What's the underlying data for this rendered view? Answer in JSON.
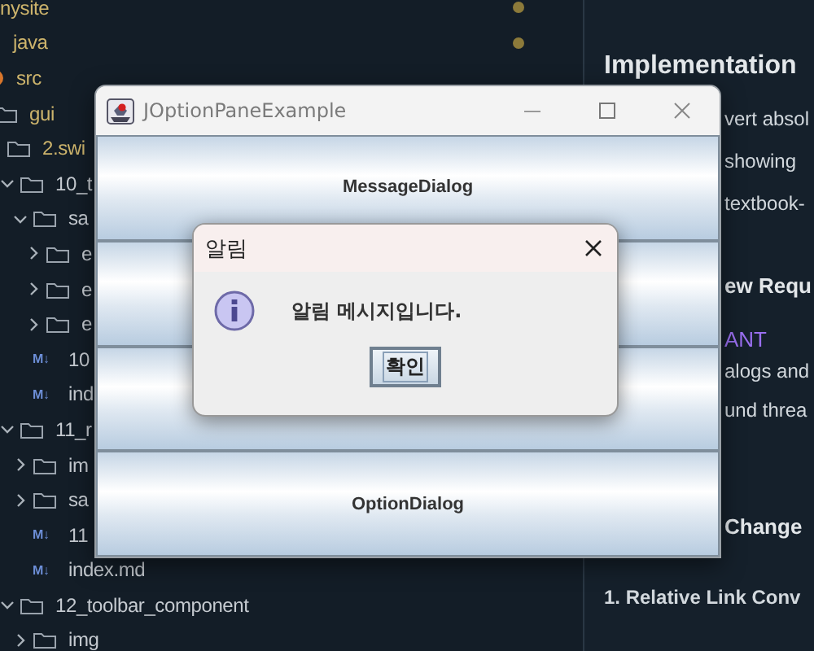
{
  "sidebar": {
    "tree": [
      {
        "label": "nysite",
        "kind": "root",
        "modified": true,
        "dirty": true,
        "children": [
          {
            "label": "java",
            "kind": "root",
            "modified": true,
            "dirty": true,
            "children": [
              {
                "label": "src",
                "kind": "source",
                "modified": true,
                "children": [
                  {
                    "label": "gui",
                    "kind": "folder",
                    "modified": true,
                    "children": [
                      {
                        "label": "2.swi",
                        "kind": "folder",
                        "modified": true,
                        "children": [
                          {
                            "label": "10_t",
                            "kind": "folder",
                            "expanded": true,
                            "children": [
                              {
                                "label": "sa",
                                "kind": "folder",
                                "expanded": true,
                                "children": [
                                  {
                                    "label": "e",
                                    "kind": "folder",
                                    "expanded": false
                                  },
                                  {
                                    "label": "e",
                                    "kind": "folder",
                                    "expanded": false
                                  },
                                  {
                                    "label": "e",
                                    "kind": "folder",
                                    "expanded": false
                                  }
                                ]
                              },
                              {
                                "label": "10",
                                "kind": "markdown",
                                "icon": "M↓"
                              },
                              {
                                "label": "ind",
                                "kind": "markdown",
                                "icon": "M↓"
                              }
                            ]
                          },
                          {
                            "label": "11_r",
                            "kind": "folder",
                            "expanded": true,
                            "children": [
                              {
                                "label": "im",
                                "kind": "folder",
                                "expanded": false
                              },
                              {
                                "label": "sa",
                                "kind": "folder",
                                "expanded": false
                              },
                              {
                                "label": "11",
                                "kind": "markdown",
                                "icon": "M↓"
                              },
                              {
                                "label": "index.md",
                                "kind": "markdown",
                                "icon": "M↓"
                              }
                            ]
                          },
                          {
                            "label": "12_toolbar_component",
                            "kind": "folder",
                            "expanded": true,
                            "children": [
                              {
                                "label": "img",
                                "kind": "folder",
                                "expanded": false
                              }
                            ]
                          }
                        ]
                      }
                    ]
                  }
                ]
              }
            ]
          }
        ]
      }
    ]
  },
  "preview": {
    "items": [
      {
        "kind": "heading",
        "text": "Implementation",
        "partial": false
      },
      {
        "kind": "text",
        "text": "vert absol",
        "partial": true
      },
      {
        "kind": "text",
        "text": "showing",
        "partial": true
      },
      {
        "kind": "text",
        "text": "textbook-",
        "partial": true
      },
      {
        "kind": "heading",
        "text": "ew Requ",
        "partial": true
      },
      {
        "kind": "label",
        "text": "ANT",
        "partial": true
      },
      {
        "kind": "text",
        "text": "alogs and",
        "partial": true
      },
      {
        "kind": "text",
        "text": "und threa",
        "partial": true
      },
      {
        "kind": "heading",
        "text": "Change",
        "partial": true
      },
      {
        "kind": "subheading",
        "text": "1. Relative Link Conv",
        "partial": false
      }
    ]
  },
  "app_window": {
    "title": "JOptionPaneExample",
    "buttons": [
      {
        "kind": "labeled",
        "label": "MessageDialog"
      },
      {
        "kind": "covered"
      },
      {
        "kind": "covered"
      },
      {
        "kind": "labeled",
        "label": "OptionDialog"
      }
    ]
  },
  "dialog": {
    "title": "알림",
    "message": "알림 메시지입니다.",
    "button": {
      "label": "확인",
      "focused": true
    }
  }
}
